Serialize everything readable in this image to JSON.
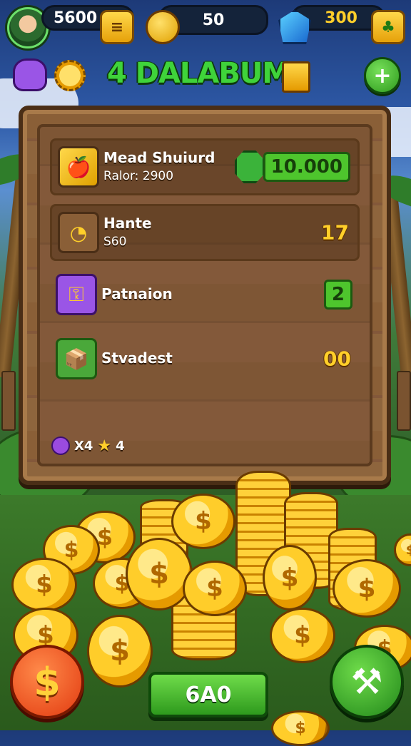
{
  "hud": {
    "coins_value": "5600",
    "coins_button_icon": "wallet-icon",
    "gems_value": "50",
    "gems_icon": "banana-icon",
    "shields_value": "300",
    "shields_icon": "blue-gem-icon",
    "shields_button_icon": "green-shop-icon"
  },
  "header": {
    "title_green": "4 DALABUM",
    "title_gold": "",
    "plus_label": "+",
    "left_icons": [
      "purple-creature-icon",
      "sun-gear-icon"
    ]
  },
  "board": {
    "items": [
      {
        "name": "Mead Shuiurd",
        "sub": "Ralor: 2900",
        "value": "10.000",
        "icon": "fruit-basket-icon",
        "style": "boxed-green"
      },
      {
        "name": "Hante",
        "sub": "S60",
        "value": "17",
        "icon": "banana-icon",
        "style": "gold"
      },
      {
        "name": "Patnaion",
        "sub": "",
        "value": "2",
        "icon": "golden-key-icon",
        "style": "boxed-green"
      },
      {
        "name": "Stvadest",
        "sub": "",
        "value": "00",
        "icon": "treasure-chest-icon",
        "style": "gold"
      }
    ],
    "footer": {
      "clock_text": "X4",
      "star_text": "4"
    }
  },
  "bottom": {
    "dollar_label": "$",
    "main_button_label": "6A0",
    "tool_label": "⚒"
  },
  "colors": {
    "accent_green": "#4ec52d",
    "gold": "#ffcf2a",
    "wood": "#8a5f37",
    "red_button": "#e23a10"
  }
}
